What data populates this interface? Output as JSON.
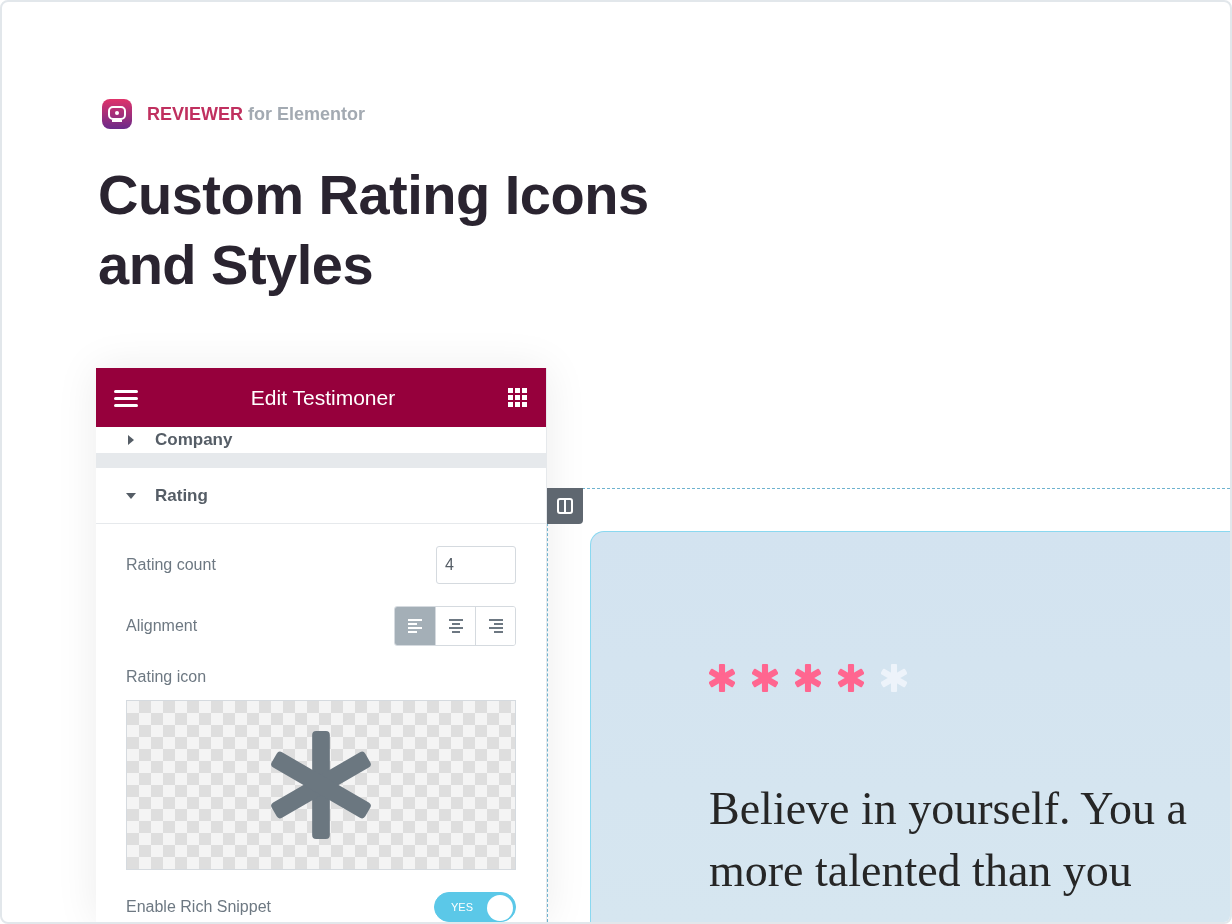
{
  "brand": {
    "name": "REVIEWER",
    "suffix": "for Elementor"
  },
  "title": [
    "Custom Rating Icons",
    "and Styles"
  ],
  "panel": {
    "title": "Edit Testimoner",
    "sections": [
      {
        "label": "Company",
        "expanded": false
      },
      {
        "label": "Rating",
        "expanded": true
      }
    ],
    "rating_count": {
      "label": "Rating count",
      "value": "4"
    },
    "alignment": {
      "label": "Alignment",
      "options": [
        {
          "kind": "left",
          "selected": true
        },
        {
          "kind": "center",
          "selected": false
        },
        {
          "kind": "right",
          "selected": false
        }
      ]
    },
    "rating_icon": {
      "label": "Rating icon"
    },
    "rich_snippet": {
      "label": "Enable Rich Snippet",
      "on": true,
      "state_text": "YES"
    }
  },
  "preview": {
    "stars": 4,
    "quote": [
      "Believe in yourself. You a",
      "more talented than you"
    ]
  }
}
